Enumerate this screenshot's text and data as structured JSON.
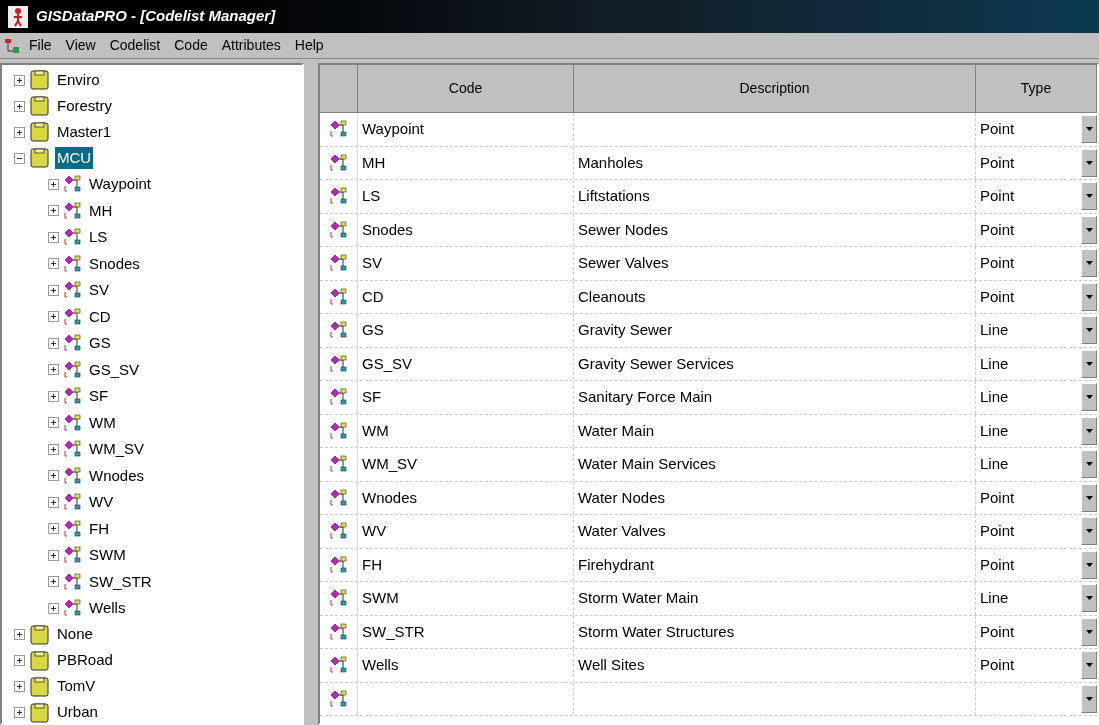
{
  "window": {
    "title": "GISDataPRO - [Codelist Manager]"
  },
  "menu": [
    "File",
    "View",
    "Codelist",
    "Code",
    "Attributes",
    "Help"
  ],
  "tree": [
    {
      "label": "Enviro",
      "expanded": false,
      "selected": false
    },
    {
      "label": "Forestry",
      "expanded": false,
      "selected": false
    },
    {
      "label": "Master1",
      "expanded": false,
      "selected": false
    },
    {
      "label": "MCU",
      "expanded": true,
      "selected": true,
      "children": [
        {
          "label": "Waypoint"
        },
        {
          "label": "MH"
        },
        {
          "label": "LS"
        },
        {
          "label": "Snodes"
        },
        {
          "label": "SV"
        },
        {
          "label": "CD"
        },
        {
          "label": "GS"
        },
        {
          "label": "GS_SV"
        },
        {
          "label": "SF"
        },
        {
          "label": "WM"
        },
        {
          "label": "WM_SV"
        },
        {
          "label": "Wnodes"
        },
        {
          "label": "WV"
        },
        {
          "label": "FH"
        },
        {
          "label": "SWM"
        },
        {
          "label": "SW_STR"
        },
        {
          "label": "Wells"
        }
      ]
    },
    {
      "label": "None",
      "expanded": false,
      "selected": false
    },
    {
      "label": "PBRoad",
      "expanded": false,
      "selected": false
    },
    {
      "label": "TomV",
      "expanded": false,
      "selected": false
    },
    {
      "label": "Urban",
      "expanded": false,
      "selected": false
    }
  ],
  "table": {
    "columns": [
      "Code",
      "Description",
      "Type"
    ],
    "rows": [
      {
        "code": "Waypoint",
        "description": "",
        "type": "Point"
      },
      {
        "code": "MH",
        "description": "Manholes",
        "type": "Point"
      },
      {
        "code": "LS",
        "description": "Liftstations",
        "type": "Point"
      },
      {
        "code": "Snodes",
        "description": "Sewer Nodes",
        "type": "Point"
      },
      {
        "code": "SV",
        "description": "Sewer Valves",
        "type": "Point"
      },
      {
        "code": "CD",
        "description": "Cleanouts",
        "type": "Point"
      },
      {
        "code": "GS",
        "description": "Gravity Sewer",
        "type": "Line"
      },
      {
        "code": "GS_SV",
        "description": "Gravity Sewer Services",
        "type": "Line"
      },
      {
        "code": "SF",
        "description": "Sanitary Force Main",
        "type": "Line"
      },
      {
        "code": "WM",
        "description": "Water Main",
        "type": "Line"
      },
      {
        "code": "WM_SV",
        "description": "Water Main Services",
        "type": "Line"
      },
      {
        "code": "Wnodes",
        "description": "Water Nodes",
        "type": "Point"
      },
      {
        "code": "WV",
        "description": "Water Valves",
        "type": "Point"
      },
      {
        "code": "FH",
        "description": "Firehydrant",
        "type": "Point"
      },
      {
        "code": "SWM",
        "description": "Storm Water Main",
        "type": "Line"
      },
      {
        "code": "SW_STR",
        "description": "Storm Water Structures",
        "type": "Point"
      },
      {
        "code": "Wells",
        "description": "Well Sites",
        "type": "Point"
      },
      {
        "code": "",
        "description": "",
        "type": ""
      }
    ]
  }
}
